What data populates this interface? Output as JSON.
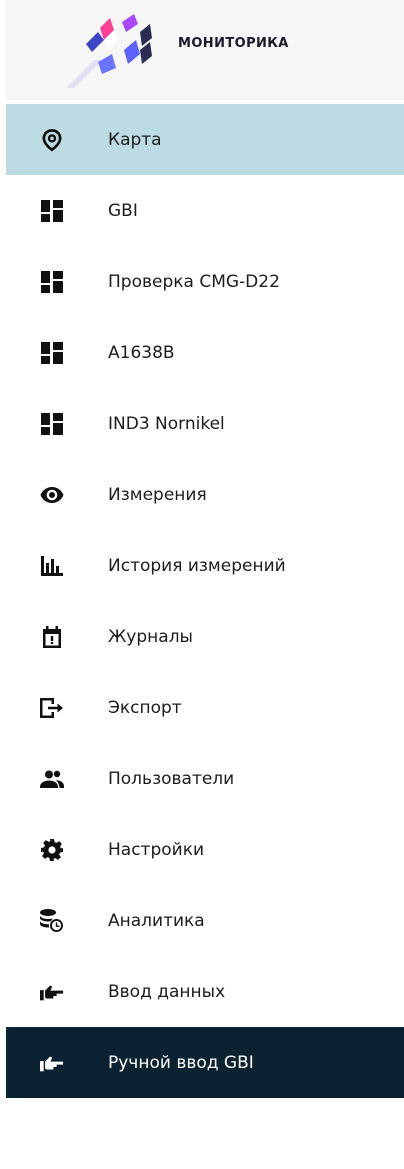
{
  "brand": {
    "name": "МОНИТОРИКА"
  },
  "menu": {
    "items": [
      {
        "label": "Карта",
        "icon": "map-pin-icon",
        "state": "active"
      },
      {
        "label": "GBI",
        "icon": "dashboard-icon"
      },
      {
        "label": "Проверка CMG-D22",
        "icon": "dashboard-icon"
      },
      {
        "label": "A1638B",
        "icon": "dashboard-icon"
      },
      {
        "label": "IND3 Nornikel",
        "icon": "dashboard-icon"
      },
      {
        "label": "Измерения",
        "icon": "eye-icon"
      },
      {
        "label": "История измерений",
        "icon": "bar-chart-icon"
      },
      {
        "label": "Журналы",
        "icon": "calendar-alert-icon"
      },
      {
        "label": "Экспорт",
        "icon": "export-icon"
      },
      {
        "label": "Пользователи",
        "icon": "users-icon"
      },
      {
        "label": "Настройки",
        "icon": "gear-icon"
      },
      {
        "label": "Аналитика",
        "icon": "database-clock-icon"
      },
      {
        "label": "Ввод данных",
        "icon": "hand-pointing-icon"
      },
      {
        "label": "Ручной ввод GBI",
        "icon": "hand-pointing-icon",
        "state": "selected-dark"
      }
    ]
  },
  "colors": {
    "active_bg": "#bcdbe2",
    "selected_dark_bg": "#0b2233",
    "brand_bg": "#f6f6f7"
  }
}
